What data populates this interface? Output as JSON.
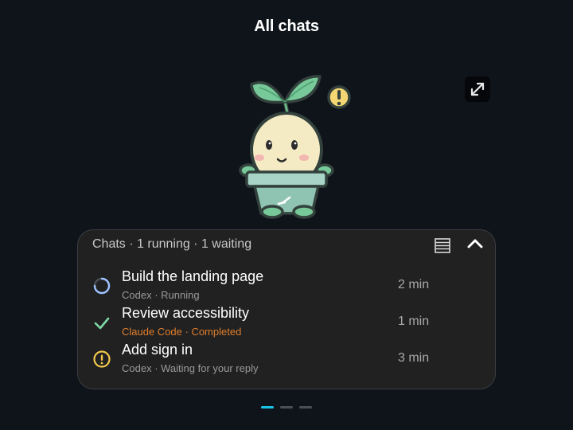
{
  "header": {
    "title": "All chats"
  },
  "panel": {
    "summary": "Chats · 1 running · 1 waiting",
    "rows": [
      {
        "title": "Build the landing page",
        "subtitle": "Codex · Running",
        "time": "2 min",
        "status": "running",
        "icon": "spinner-icon"
      },
      {
        "title": "Review accessibility",
        "subtitle": "Claude Code · Completed",
        "time": "1 min",
        "status": "completed",
        "icon": "check-icon"
      },
      {
        "title": "Add sign in",
        "subtitle": "Codex · Waiting for your reply",
        "time": "3 min",
        "status": "waiting",
        "icon": "alert-icon"
      }
    ]
  },
  "pagination": {
    "count": 3,
    "active": 1
  },
  "colors": {
    "background": "#0f141b",
    "panel": "#212121",
    "accent": "#19c3e6",
    "completed": "#e07e2e",
    "check": "#7ed9a6",
    "warning": "#f2c94c"
  }
}
